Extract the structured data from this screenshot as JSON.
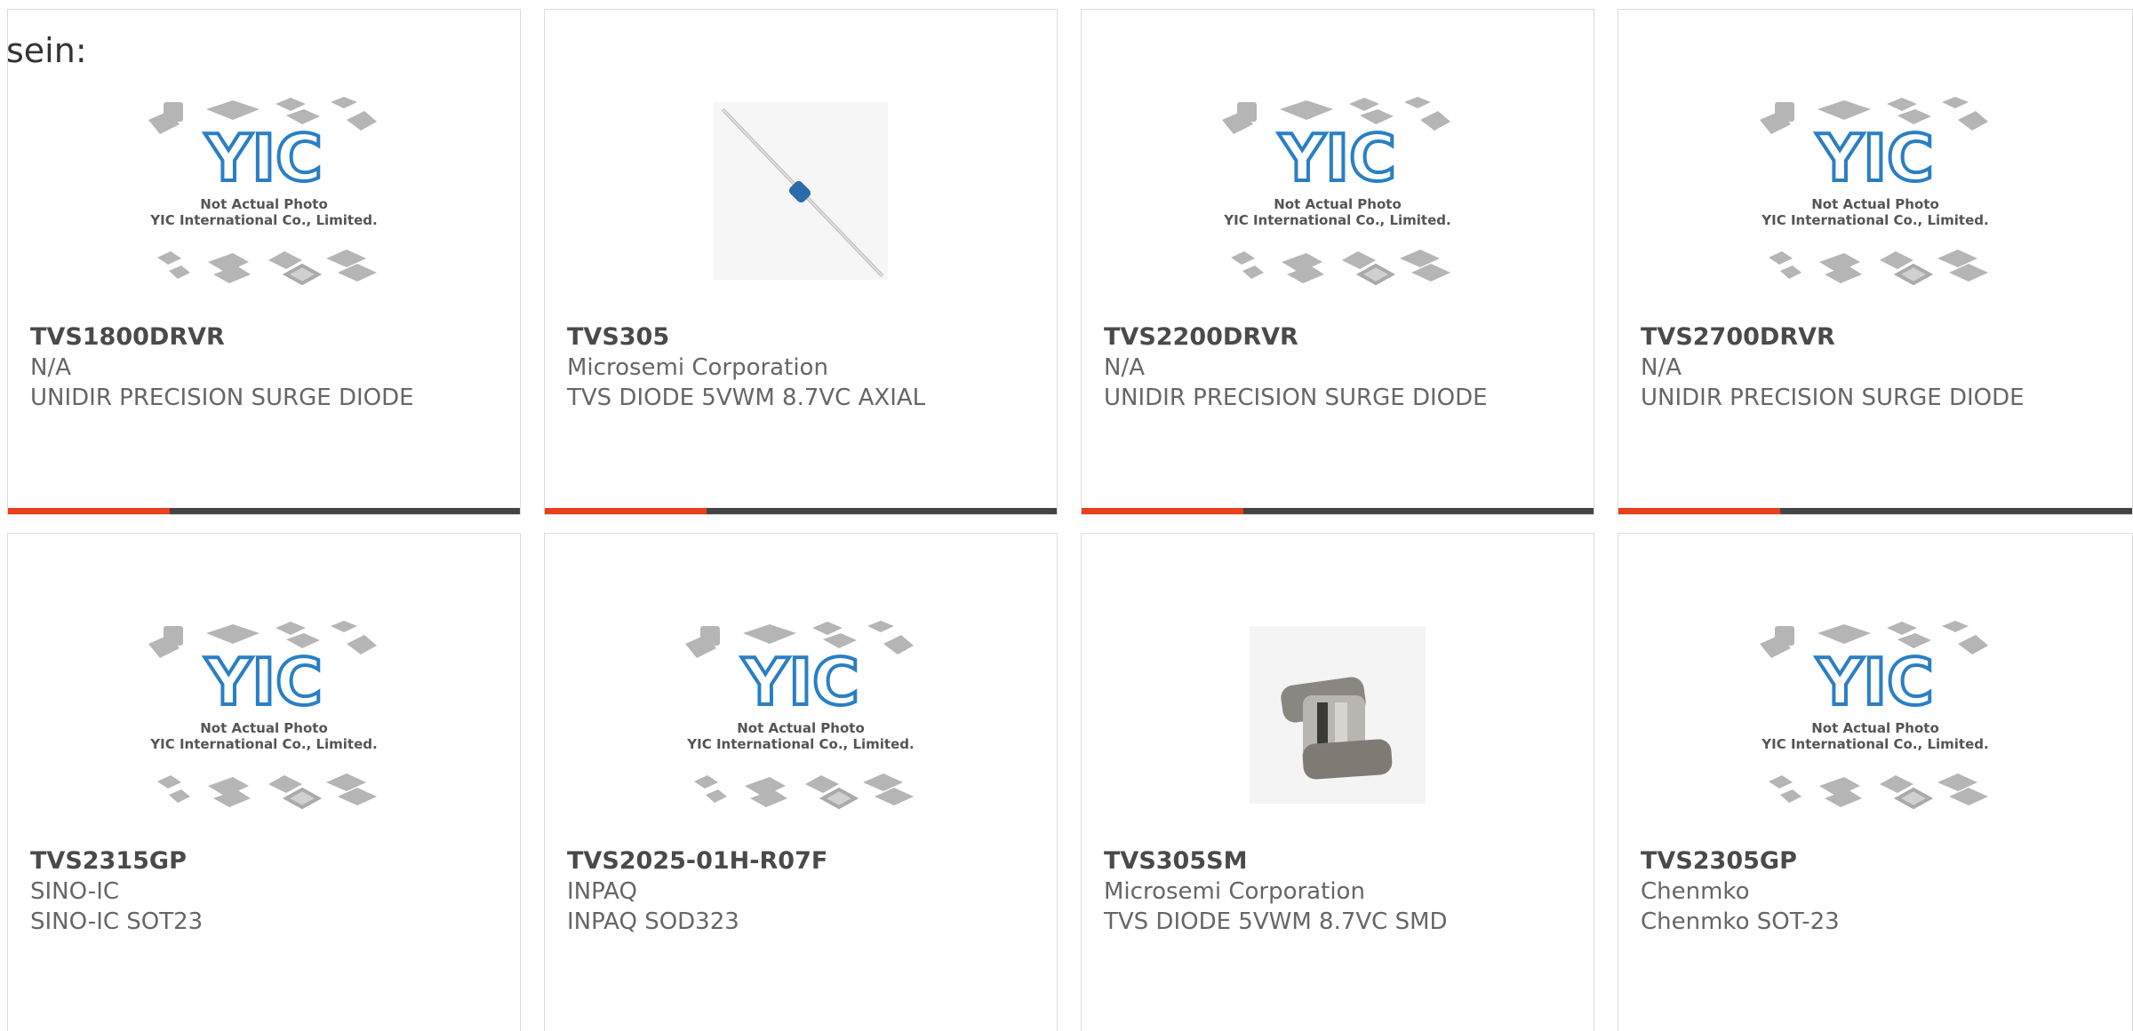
{
  "intro_text": "sein:",
  "placeholder": {
    "logo_text": "YIC",
    "line1": "Not Actual Photo",
    "line2": "YIC International Co., Limited."
  },
  "cards": [
    {
      "part": "TVS1800DRVR",
      "mfr": "N/A",
      "desc": "UNIDIR PRECISION SURGE DIODE",
      "image": "placeholder",
      "accent": "#e8401c"
    },
    {
      "part": "TVS305",
      "mfr": "Microsemi Corporation",
      "desc": "TVS DIODE 5VWM 8.7VC AXIAL",
      "image": "axial-diode-photo",
      "accent": "#e8401c"
    },
    {
      "part": "TVS2200DRVR",
      "mfr": "N/A",
      "desc": "UNIDIR PRECISION SURGE DIODE",
      "image": "placeholder",
      "accent": "#e8401c"
    },
    {
      "part": "TVS2700DRVR",
      "mfr": "N/A",
      "desc": "UNIDIR PRECISION SURGE DIODE",
      "image": "placeholder",
      "accent": "#e8401c"
    },
    {
      "part": "TVS2315GP",
      "mfr": "SINO-IC",
      "desc": "SINO-IC SOT23",
      "image": "placeholder"
    },
    {
      "part": "TVS2025-01H-R07F",
      "mfr": "INPAQ",
      "desc": "INPAQ SOD323",
      "image": "placeholder"
    },
    {
      "part": "TVS305SM",
      "mfr": "Microsemi Corporation",
      "desc": "TVS DIODE 5VWM 8.7VC SMD",
      "image": "smd-diode-photo"
    },
    {
      "part": "TVS2305GP",
      "mfr": "Chenmko",
      "desc": "Chenmko SOT-23",
      "image": "placeholder"
    }
  ]
}
